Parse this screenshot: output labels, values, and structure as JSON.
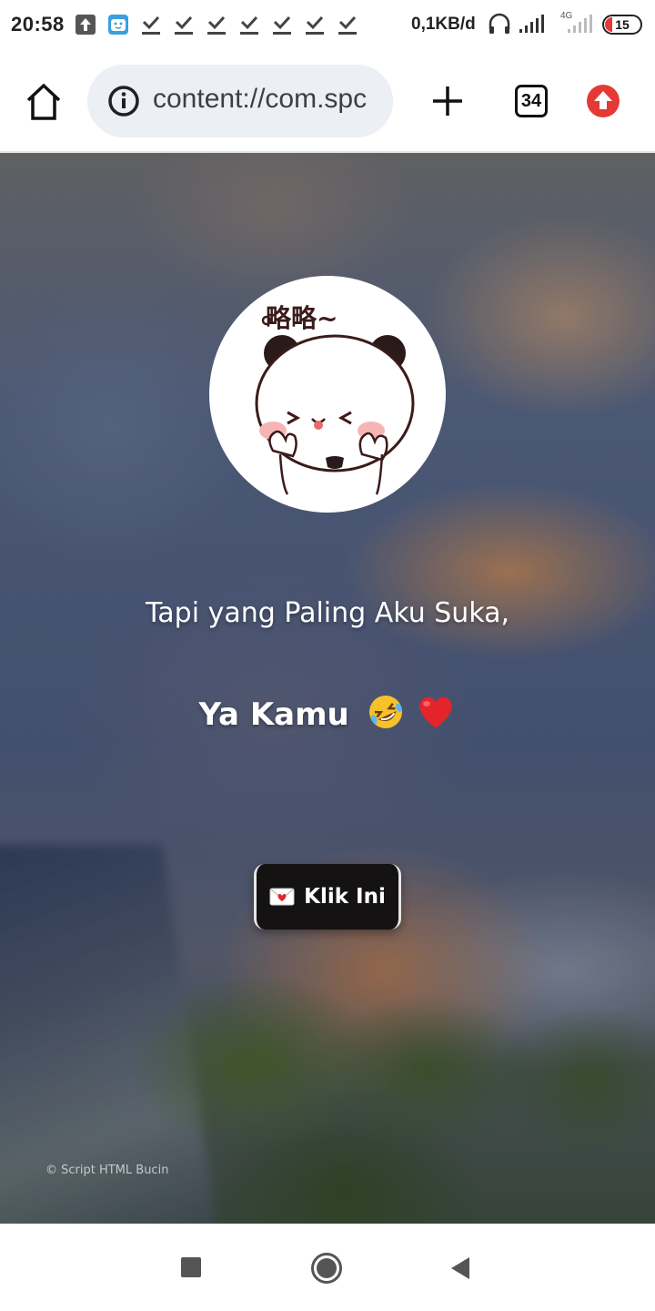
{
  "status_bar": {
    "time": "20:58",
    "notification_icons": [
      "upload-icon",
      "app-face-icon",
      "download-done-icon",
      "download-done-icon",
      "download-done-icon",
      "download-done-icon",
      "download-done-icon",
      "download-done-icon",
      "download-done-icon"
    ],
    "network_speed": "0,1KB/d",
    "network_type": "4G",
    "battery_level": "15"
  },
  "toolbar": {
    "url": "content://com.spc",
    "tab_count": "34"
  },
  "content": {
    "sticker_text": "略略~",
    "line1": "Tapi yang Paling Aku Suka,",
    "line2": "Ya Kamu",
    "line2_emojis": [
      "rolling-laughing-emoji",
      "red-heart-emoji"
    ],
    "button_label": "Klik Ini",
    "button_icon": "love-letter-icon",
    "footer": "© Script HTML Bucin"
  },
  "colors": {
    "button_bg": "#141212",
    "update_badge": "#e53935"
  }
}
